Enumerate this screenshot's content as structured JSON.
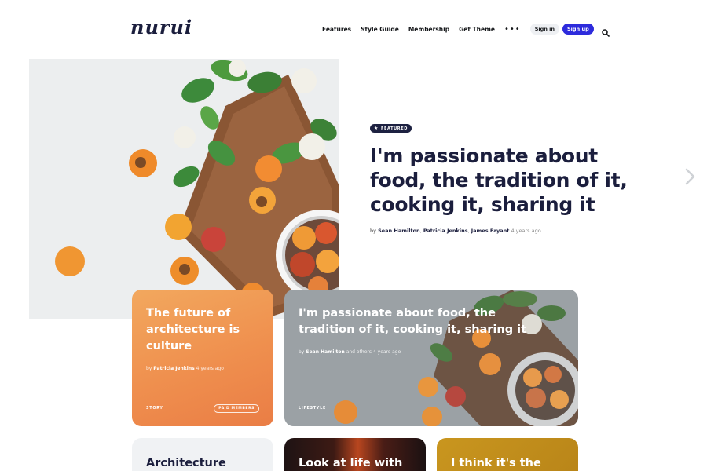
{
  "header": {
    "logo": "nurui",
    "nav": [
      "Features",
      "Style Guide",
      "Membership",
      "Get Theme"
    ],
    "more": "•••",
    "signin": "Sign in",
    "signup": "Sign up"
  },
  "hero": {
    "badge": "FEATURED",
    "title": "I'm passionate about food, the tradition of it, cooking it, sharing it",
    "by": "by",
    "authors": [
      "Sean Hamilton",
      "Patricia Jenkins",
      "James Bryant"
    ],
    "time": "4 years ago"
  },
  "cards": [
    {
      "title": "The future of architecture is culture",
      "by": "by",
      "author": "Patricia Jenkins",
      "time": "4 years ago",
      "tag": "STORY",
      "badge": "PAID MEMBERS"
    },
    {
      "title": "I'm passionate about food, the tradition of it, cooking it, sharing it",
      "by": "by",
      "author": "Sean Hamilton",
      "others": "and others",
      "time": "4 years ago",
      "tag": "LIFESTYLE"
    }
  ],
  "bottom_cards": [
    {
      "title": "Architecture"
    },
    {
      "title": "Look at life with"
    },
    {
      "title": "I think it's the"
    }
  ],
  "colors": {
    "accent": "#2d2bdc",
    "heading": "#1b1e3d",
    "card_orange": "#ef8f4e",
    "card_gold": "#c9961f"
  }
}
